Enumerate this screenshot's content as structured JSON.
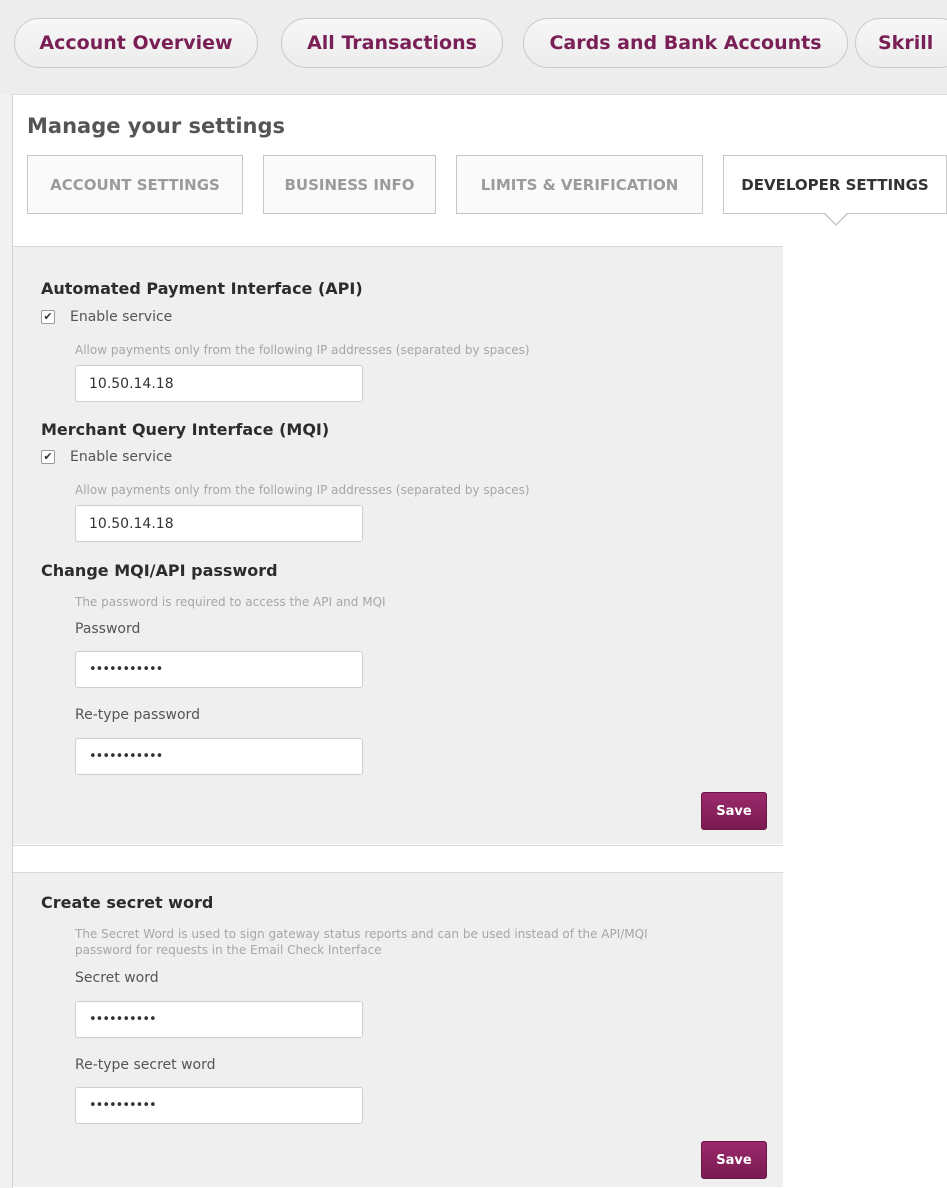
{
  "top_nav": {
    "items": [
      "Account Overview",
      "All Transactions",
      "Cards and Bank Accounts",
      "Skrill"
    ]
  },
  "page": {
    "title": "Manage your settings",
    "tabs": [
      "ACCOUNT SETTINGS",
      "BUSINESS INFO",
      "LIMITS & VERIFICATION",
      "DEVELOPER SETTINGS"
    ],
    "active_tab": "DEVELOPER SETTINGS"
  },
  "api": {
    "title": "Automated Payment Interface (API)",
    "enable_label": "Enable service",
    "enabled": true,
    "check_glyph": "✔",
    "ip_hint": "Allow payments only from the following IP addresses (separated by spaces)",
    "ip_value": "10.50.14.18"
  },
  "mqi": {
    "title": "Merchant Query Interface (MQI)",
    "enable_label": "Enable service",
    "enabled": true,
    "check_glyph": "✔",
    "ip_hint": "Allow payments only from the following IP addresses (separated by spaces)",
    "ip_value": "10.50.14.18"
  },
  "password": {
    "title": "Change MQI/API password",
    "hint": "The password is required to access the API and MQI",
    "password_label": "Password",
    "password_value": "•••••••••••",
    "retype_label": "Re-type password",
    "retype_value": "•••••••••••",
    "save_label": "Save"
  },
  "secret": {
    "title": "Create secret word",
    "hint_line1": "The Secret Word is used to sign gateway status reports and can be used instead of the API/MQI",
    "hint_line2": "password for requests in the Email Check Interface",
    "secret_label": "Secret word",
    "secret_value": "••••••••••",
    "retype_label": "Re-type secret word",
    "retype_value": "••••••••••",
    "save_label": "Save"
  },
  "colors": {
    "brand": "#7a1f56",
    "save_button": "#8a2160",
    "section_bg": "#efefef"
  }
}
